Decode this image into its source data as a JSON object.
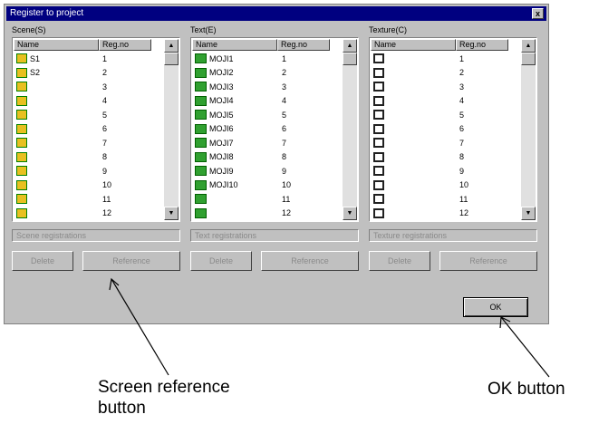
{
  "window": {
    "title": "Register to project",
    "close_glyph": "x"
  },
  "panels": [
    {
      "label": "Scene(S)",
      "columns": [
        "Name",
        "Reg.no"
      ],
      "icon": "scene-icon",
      "rows": [
        {
          "name": "S1",
          "regno": "1"
        },
        {
          "name": "S2",
          "regno": "2"
        },
        {
          "name": "",
          "regno": "3"
        },
        {
          "name": "",
          "regno": "4"
        },
        {
          "name": "",
          "regno": "5"
        },
        {
          "name": "",
          "regno": "6"
        },
        {
          "name": "",
          "regno": "7"
        },
        {
          "name": "",
          "regno": "8"
        },
        {
          "name": "",
          "regno": "9"
        },
        {
          "name": "",
          "regno": "10"
        },
        {
          "name": "",
          "regno": "11"
        },
        {
          "name": "",
          "regno": "12"
        }
      ],
      "status": "Scene registrations",
      "buttons": [
        "Delete",
        "Reference"
      ]
    },
    {
      "label": "Text(E)",
      "columns": [
        "Name",
        "Reg.no"
      ],
      "icon": "text-icon",
      "rows": [
        {
          "name": "MOJI1",
          "regno": "1"
        },
        {
          "name": "MOJI2",
          "regno": "2"
        },
        {
          "name": "MOJI3",
          "regno": "3"
        },
        {
          "name": "MOJI4",
          "regno": "4"
        },
        {
          "name": "MOJI5",
          "regno": "5"
        },
        {
          "name": "MOJI6",
          "regno": "6"
        },
        {
          "name": "MOJI7",
          "regno": "7"
        },
        {
          "name": "MOJI8",
          "regno": "8"
        },
        {
          "name": "MOJI9",
          "regno": "9"
        },
        {
          "name": "MOJI10",
          "regno": "10"
        },
        {
          "name": "",
          "regno": "11"
        },
        {
          "name": "",
          "regno": "12"
        }
      ],
      "status": "Text registrations",
      "buttons": [
        "Delete",
        "Reference"
      ]
    },
    {
      "label": "Texture(C)",
      "columns": [
        "Name",
        "Reg.no"
      ],
      "icon": "texture-icon",
      "rows": [
        {
          "name": "",
          "regno": "1"
        },
        {
          "name": "",
          "regno": "2"
        },
        {
          "name": "",
          "regno": "3"
        },
        {
          "name": "",
          "regno": "4"
        },
        {
          "name": "",
          "regno": "5"
        },
        {
          "name": "",
          "regno": "6"
        },
        {
          "name": "",
          "regno": "7"
        },
        {
          "name": "",
          "regno": "8"
        },
        {
          "name": "",
          "regno": "9"
        },
        {
          "name": "",
          "regno": "10"
        },
        {
          "name": "",
          "regno": "11"
        },
        {
          "name": "",
          "regno": "12"
        }
      ],
      "status": "Texture registrations",
      "buttons": [
        "Delete",
        "Reference"
      ]
    }
  ],
  "ok_label": "OK",
  "callouts": {
    "screen_reference": [
      "Screen reference",
      "button"
    ],
    "ok": "OK button"
  },
  "scroll": {
    "up_glyph": "▲",
    "down_glyph": "▼"
  }
}
